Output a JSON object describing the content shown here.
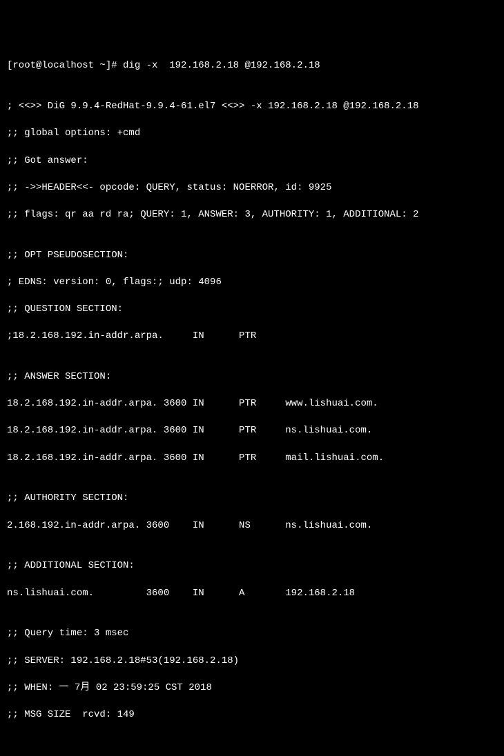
{
  "prompt": "[root@localhost ~]# dig -x  192.168.2.18 @192.168.2.18",
  "blank1": "",
  "banner": "; <<>> DiG 9.9.4-RedHat-9.9.4-61.el7 <<>> -x 192.168.2.18 @192.168.2.18",
  "global_options": ";; global options: +cmd",
  "got_answer": ";; Got answer:",
  "header_line": ";; ->>HEADER<<- opcode: QUERY, status: NOERROR, id: 9925",
  "flags_line": ";; flags: qr aa rd ra; QUERY: 1, ANSWER: 3, AUTHORITY: 1, ADDITIONAL: 2",
  "blank2": "",
  "opt_header": ";; OPT PSEUDOSECTION:",
  "edns": "; EDNS: version: 0, flags:; udp: 4096",
  "question_header": ";; QUESTION SECTION:",
  "question_record": ";18.2.168.192.in-addr.arpa.     IN      PTR",
  "blank3": "",
  "answer_header": ";; ANSWER SECTION:",
  "answer1": "18.2.168.192.in-addr.arpa. 3600 IN      PTR     www.lishuai.com.",
  "answer2": "18.2.168.192.in-addr.arpa. 3600 IN      PTR     ns.lishuai.com.",
  "answer3": "18.2.168.192.in-addr.arpa. 3600 IN      PTR     mail.lishuai.com.",
  "blank4": "",
  "authority_header": ";; AUTHORITY SECTION:",
  "authority1": "2.168.192.in-addr.arpa. 3600    IN      NS      ns.lishuai.com.",
  "blank5": "",
  "additional_header": ";; ADDITIONAL SECTION:",
  "additional1": "ns.lishuai.com.         3600    IN      A       192.168.2.18",
  "blank6": "",
  "query_time": ";; Query time: 3 msec",
  "server": ";; SERVER: 192.168.2.18#53(192.168.2.18)",
  "when": ";; WHEN: 一 7月 02 23:59:25 CST 2018",
  "msg_size": ";; MSG SIZE  rcvd: 149"
}
